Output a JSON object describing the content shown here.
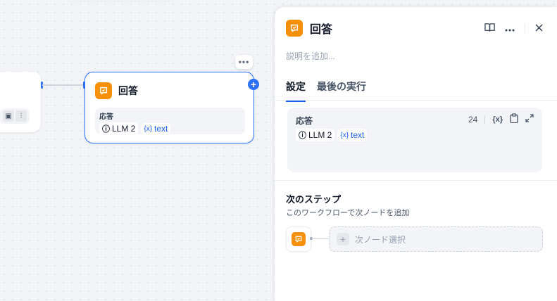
{
  "canvas": {
    "node": {
      "title": "回答",
      "body_label": "応答",
      "vars": [
        {
          "prefix": "ⓘ",
          "label": "LLM 2"
        },
        {
          "prefix": "{x}",
          "label": "text"
        }
      ],
      "more_glyph": "•••",
      "add_glyph": "+"
    },
    "left_node_tools": [
      "image-icon",
      "audio-icon"
    ]
  },
  "panel": {
    "title": "回答",
    "description_placeholder": "説明を追加...",
    "tabs": [
      {
        "label": "設定",
        "active": true
      },
      {
        "label": "最後の実行",
        "active": false
      }
    ],
    "response": {
      "label": "応答",
      "count": "24",
      "vars": [
        {
          "prefix": "ⓘ",
          "label": "LLM 2"
        },
        {
          "prefix": "{x}",
          "label": "text"
        }
      ]
    },
    "next_step": {
      "title": "次のステップ",
      "description": "このワークフローで次ノードを追加",
      "select_label": "次ノード選択"
    }
  },
  "colors": {
    "accent": "#2970ff",
    "answer_icon": "#f79009",
    "variable_text": "#155eef"
  }
}
